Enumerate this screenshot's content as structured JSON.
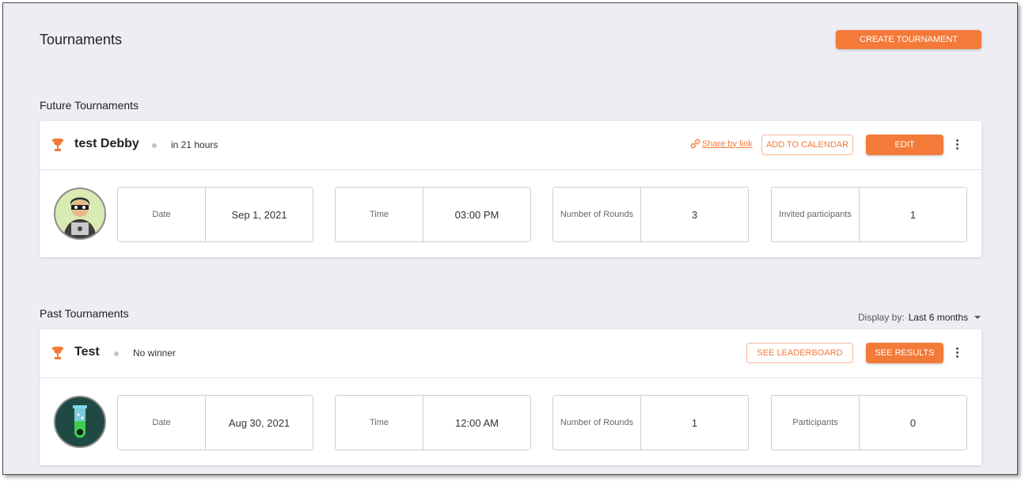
{
  "page": {
    "title": "Tournaments",
    "create_button": "CREATE TOURNAMENT"
  },
  "future": {
    "section_title": "Future Tournaments",
    "tournament": {
      "name": "test Debby",
      "status": "in 21 hours",
      "share_label": "Share by link",
      "calendar_label": "ADD TO CALENDAR",
      "edit_label": "EDIT",
      "stats": [
        {
          "label": "Date",
          "value": "Sep 1, 2021"
        },
        {
          "label": "Time",
          "value": "03:00 PM"
        },
        {
          "label": "Number of Rounds",
          "value": "3"
        },
        {
          "label": "Invited participants",
          "value": "1"
        }
      ]
    }
  },
  "past": {
    "section_title": "Past Tournaments",
    "display_by_label": "Display by:",
    "display_by_value": "Last 6 months",
    "tournament": {
      "name": "Test",
      "status": "No winner",
      "leaderboard_label": "SEE LEADERBOARD",
      "results_label": "SEE RESULTS",
      "stats": [
        {
          "label": "Date",
          "value": "Aug 30, 2021"
        },
        {
          "label": "Time",
          "value": "12:00 AM"
        },
        {
          "label": "Number of Rounds",
          "value": "1"
        },
        {
          "label": "Participants",
          "value": "0"
        }
      ]
    }
  },
  "colors": {
    "accent": "#f47a3a",
    "background": "#eceef3"
  },
  "icons": {
    "trophy": "trophy-icon",
    "link": "link-icon",
    "menu": "kebab-menu-icon",
    "dropdown": "caret-down-icon"
  }
}
